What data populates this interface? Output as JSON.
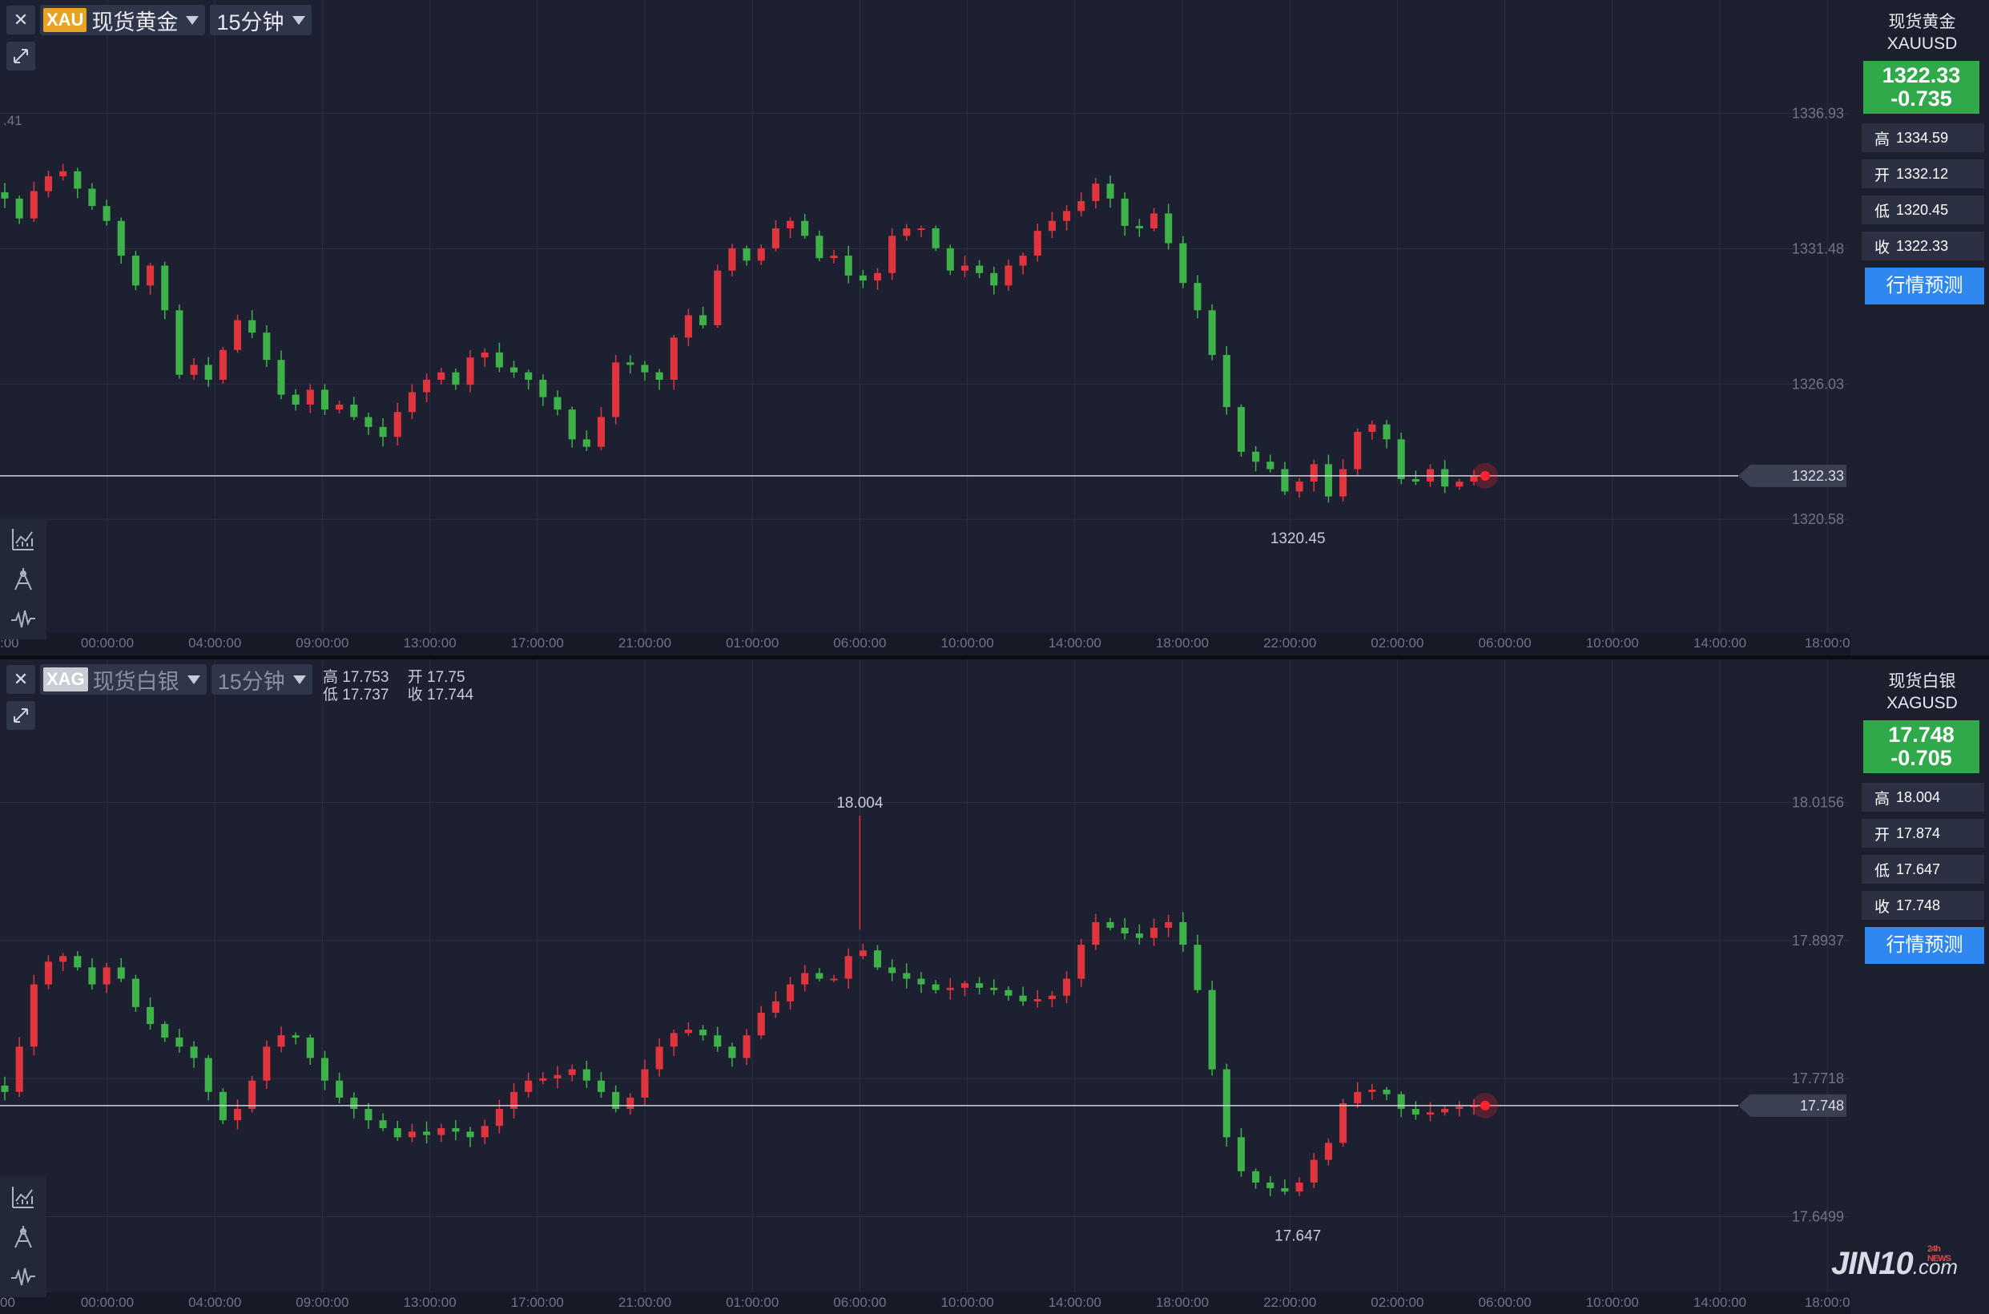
{
  "colors": {
    "up": "#e0353e",
    "down": "#3eb14a",
    "grid": "#2a3042",
    "axis_text": "#6f7587",
    "price_line": "#d0d4dc",
    "price_tag_bg": "#3a3f52",
    "marker": "#ff2030"
  },
  "gold": {
    "tag": "XAU",
    "symbol_name": "现货黄金",
    "timeframe": "15分钟",
    "sidebar": {
      "name": "现货黄金",
      "code": "XAUUSD",
      "price": "1322.33",
      "change": "-0.735",
      "high_label": "高",
      "high": "1334.59",
      "open_label": "开",
      "open": "1332.12",
      "low_label": "低",
      "low": "1320.45",
      "close_label": "收",
      "close": "1322.33",
      "forecast_label": "行情预测"
    }
  },
  "silver": {
    "tag": "XAG",
    "symbol_name": "现货白银",
    "timeframe": "15分钟",
    "inline_ohlc": {
      "high_label": "高",
      "high": "17.753",
      "open_label": "开",
      "open": "17.75",
      "low_label": "低",
      "low": "17.737",
      "close_label": "收",
      "close": "17.744"
    },
    "sidebar": {
      "name": "现货白银",
      "code": "XAGUSD",
      "price": "17.748",
      "change": "-0.705",
      "high_label": "高",
      "high": "18.004",
      "open_label": "开",
      "open": "17.874",
      "low_label": "低",
      "low": "17.647",
      "close_label": "收",
      "close": "17.748",
      "forecast_label": "行情预测"
    }
  },
  "logo": {
    "text": "JIN10",
    "suffix": ".com",
    "badge": "24h NEWS"
  },
  "chart_data": [
    {
      "type": "candlestick",
      "symbol": "XAUUSD",
      "interval": "15分钟",
      "x_ticks": [
        "00:00:00",
        "04:00:00",
        "09:00:00",
        "13:00:00",
        "17:00:00",
        "21:00:00",
        "01:00:00",
        "06:00:00",
        "10:00:00",
        "14:00:00",
        "18:00:00",
        "22:00:00",
        "02:00:00",
        "06:00:00",
        "10:00:00",
        "14:00:00",
        "18:00:0"
      ],
      "x_edge_label": ":00",
      "y_ticks": [
        "1336.93",
        "1331.48",
        "1326.03",
        "1320.58"
      ],
      "y_tick_values": [
        1336.93,
        1331.48,
        1326.03,
        1320.58
      ],
      "left_edge_label": ".41",
      "ylim": [
        1316.0,
        1341.5
      ],
      "current_price": 1322.33,
      "current_price_label": "1322.33",
      "low_annotation": {
        "value": 1320.45,
        "label": "1320.45",
        "tick": "22:00:00"
      },
      "close_series": [
        1333.5,
        1332.7,
        1333.8,
        1334.4,
        1334.6,
        1333.9,
        1333.2,
        1332.6,
        1331.2,
        1330.0,
        1330.8,
        1329.0,
        1326.4,
        1326.8,
        1326.2,
        1327.4,
        1328.6,
        1328.1,
        1327.0,
        1325.6,
        1325.2,
        1325.8,
        1325.0,
        1325.2,
        1324.7,
        1324.3,
        1323.9,
        1324.9,
        1325.7,
        1326.2,
        1326.5,
        1326.0,
        1327.1,
        1327.3,
        1326.7,
        1326.5,
        1326.2,
        1325.5,
        1325.0,
        1323.8,
        1323.5,
        1324.7,
        1326.9,
        1326.8,
        1326.5,
        1326.2,
        1327.9,
        1328.8,
        1328.4,
        1330.6,
        1331.5,
        1331.0,
        1331.5,
        1332.3,
        1332.6,
        1332.0,
        1331.1,
        1331.2,
        1330.4,
        1330.2,
        1330.5,
        1332.0,
        1332.3,
        1332.3,
        1331.5,
        1330.6,
        1330.8,
        1330.5,
        1330.0,
        1330.8,
        1331.2,
        1332.2,
        1332.6,
        1333.0,
        1333.4,
        1334.1,
        1333.5,
        1332.4,
        1332.3,
        1332.9,
        1331.7,
        1330.1,
        1329.0,
        1327.2,
        1325.1,
        1323.3,
        1322.9,
        1322.6,
        1321.7,
        1322.1,
        1322.8,
        1321.5,
        1322.6,
        1324.1,
        1324.4,
        1323.8,
        1322.2,
        1322.1,
        1322.6,
        1321.9,
        1322.1,
        1322.33
      ]
    },
    {
      "type": "candlestick",
      "symbol": "XAGUSD",
      "interval": "15分钟",
      "x_ticks": [
        "00:00:00",
        "04:00:00",
        "09:00:00",
        "13:00:00",
        "17:00:00",
        "21:00:00",
        "01:00:00",
        "06:00:00",
        "10:00:00",
        "14:00:00",
        "18:00:00",
        "22:00:00",
        "02:00:00",
        "06:00:00",
        "10:00:00",
        "14:00:00",
        "18:00:0"
      ],
      "x_edge_label": "00",
      "y_ticks": [
        "18.0156",
        "17.8937",
        "17.7718",
        "17.6499"
      ],
      "y_tick_values": [
        18.0156,
        17.8937,
        17.7718,
        17.6499
      ],
      "ylim": [
        17.583,
        18.142
      ],
      "current_price": 17.748,
      "current_price_label": "17.748",
      "high_annotation": {
        "value": 18.004,
        "label": "18.004",
        "tick": "06:00:00"
      },
      "low_annotation": {
        "value": 17.647,
        "label": "17.647",
        "tick": "22:00:00"
      },
      "close_series": [
        17.76,
        17.8,
        17.855,
        17.875,
        17.88,
        17.87,
        17.855,
        17.87,
        17.86,
        17.835,
        17.82,
        17.808,
        17.8,
        17.79,
        17.76,
        17.735,
        17.745,
        17.77,
        17.8,
        17.81,
        17.808,
        17.79,
        17.77,
        17.755,
        17.745,
        17.735,
        17.728,
        17.72,
        17.725,
        17.722,
        17.728,
        17.725,
        17.72,
        17.73,
        17.745,
        17.76,
        17.77,
        17.772,
        17.775,
        17.78,
        17.77,
        17.76,
        17.745,
        17.755,
        17.78,
        17.8,
        17.812,
        17.815,
        17.81,
        17.8,
        17.79,
        17.81,
        17.83,
        17.84,
        17.855,
        17.865,
        17.86,
        17.86,
        17.88,
        17.885,
        17.87,
        17.865,
        17.86,
        17.855,
        17.85,
        17.852,
        17.856,
        17.852,
        17.85,
        17.845,
        17.84,
        17.842,
        17.845,
        17.86,
        17.89,
        17.91,
        17.905,
        17.9,
        17.896,
        17.905,
        17.91,
        17.89,
        17.85,
        17.78,
        17.72,
        17.69,
        17.68,
        17.675,
        17.672,
        17.68,
        17.7,
        17.715,
        17.75,
        17.76,
        17.762,
        17.758,
        17.745,
        17.74,
        17.742,
        17.745,
        17.747,
        17.748
      ]
    }
  ]
}
